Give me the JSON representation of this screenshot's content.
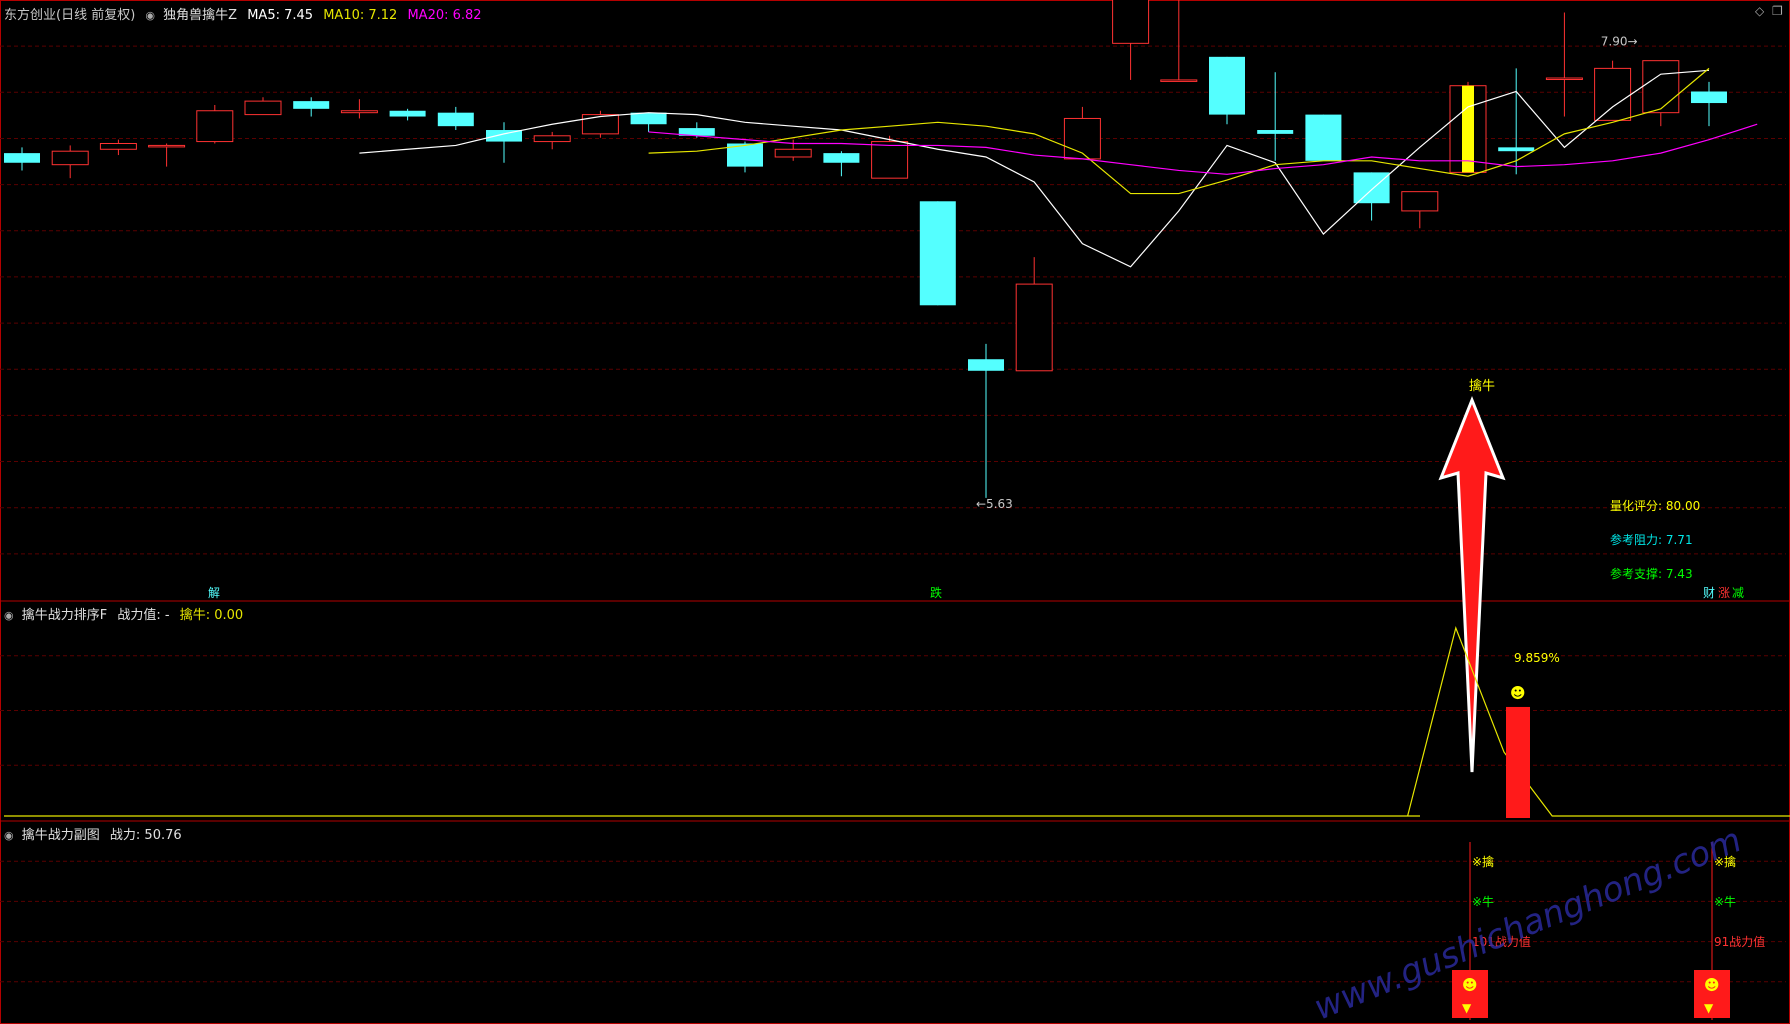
{
  "header": {
    "stock": "东方创业(日线 前复权)",
    "indicator": "独角兽擒牛Z",
    "ma5_label": "MA5: 7.45",
    "ma10_label": "MA10: 7.12",
    "ma20_label": "MA20: 6.82",
    "diamond_icon": "diamond-icon",
    "restore_icon": "window-restore-icon"
  },
  "sub1_header": {
    "name": "擒牛战力排序F",
    "label_a": "战力值: -",
    "label_b": "擒牛: 0.00"
  },
  "sub2_header": {
    "name": "擒牛战力副图",
    "label": "战力: 50.76"
  },
  "colors": {
    "up": "#ff3232",
    "down": "#54ffff",
    "ma5": "#ffffff",
    "ma10": "#e6e600",
    "ma20": "#ff00ff",
    "grid": "#5a0000",
    "frame": "#b40000",
    "yellow": "#ffff00",
    "cyan": "#00e6e6",
    "green": "#00ff00"
  },
  "chart_data": {
    "type": "candlestick",
    "ylim": [
      5.1,
      8.08
    ],
    "candles": [
      {
        "o": 7.42,
        "h": 7.45,
        "l": 7.33,
        "c": 7.37
      },
      {
        "o": 7.36,
        "h": 7.46,
        "l": 7.29,
        "c": 7.43
      },
      {
        "o": 7.44,
        "h": 7.49,
        "l": 7.41,
        "c": 7.47
      },
      {
        "o": 7.46,
        "h": 7.47,
        "l": 7.35,
        "c": 7.46
      },
      {
        "o": 7.48,
        "h": 7.67,
        "l": 7.47,
        "c": 7.64
      },
      {
        "o": 7.62,
        "h": 7.71,
        "l": 7.62,
        "c": 7.69
      },
      {
        "o": 7.69,
        "h": 7.71,
        "l": 7.61,
        "c": 7.65
      },
      {
        "o": 7.63,
        "h": 7.7,
        "l": 7.6,
        "c": 7.64
      },
      {
        "o": 7.64,
        "h": 7.65,
        "l": 7.59,
        "c": 7.61
      },
      {
        "o": 7.63,
        "h": 7.66,
        "l": 7.54,
        "c": 7.56
      },
      {
        "o": 7.54,
        "h": 7.58,
        "l": 7.37,
        "c": 7.48
      },
      {
        "o": 7.48,
        "h": 7.53,
        "l": 7.44,
        "c": 7.51
      },
      {
        "o": 7.52,
        "h": 7.64,
        "l": 7.5,
        "c": 7.62
      },
      {
        "o": 7.63,
        "h": 7.63,
        "l": 7.53,
        "c": 7.57
      },
      {
        "o": 7.55,
        "h": 7.58,
        "l": 7.5,
        "c": 7.51
      },
      {
        "o": 7.47,
        "h": 7.48,
        "l": 7.32,
        "c": 7.35
      },
      {
        "o": 7.4,
        "h": 7.49,
        "l": 7.38,
        "c": 7.44
      },
      {
        "o": 7.42,
        "h": 7.43,
        "l": 7.3,
        "c": 7.37
      },
      {
        "o": 7.29,
        "h": 7.51,
        "l": 7.29,
        "c": 7.48
      },
      {
        "o": 7.17,
        "h": 7.17,
        "l": 6.63,
        "c": 6.63
      },
      {
        "o": 6.35,
        "h": 6.43,
        "l": 5.63,
        "c": 6.29
      },
      {
        "o": 6.29,
        "h": 6.88,
        "l": 6.29,
        "c": 6.74
      },
      {
        "o": 7.39,
        "h": 7.66,
        "l": 7.39,
        "c": 7.6
      },
      {
        "o": 7.99,
        "h": 8.39,
        "l": 7.8,
        "c": 8.55
      },
      {
        "o": 7.8,
        "h": 8.32,
        "l": 7.8,
        "c": 7.8
      },
      {
        "o": 7.92,
        "h": 7.92,
        "l": 7.57,
        "c": 7.62
      },
      {
        "o": 7.54,
        "h": 7.84,
        "l": 7.38,
        "c": 7.52
      },
      {
        "o": 7.62,
        "h": 7.62,
        "l": 7.38,
        "c": 7.38
      },
      {
        "o": 7.32,
        "h": 7.32,
        "l": 7.07,
        "c": 7.16
      },
      {
        "o": 7.12,
        "h": 7.22,
        "l": 7.03,
        "c": 7.22
      },
      {
        "o": 7.32,
        "h": 7.79,
        "l": 7.32,
        "c": 7.77
      },
      {
        "o": 7.45,
        "h": 7.86,
        "l": 7.31,
        "c": 7.43
      },
      {
        "o": 7.81,
        "h": 8.15,
        "l": 7.61,
        "c": 7.81
      },
      {
        "o": 7.59,
        "h": 7.9,
        "l": 7.66,
        "c": 7.86
      },
      {
        "o": 7.63,
        "h": 7.9,
        "l": 7.56,
        "c": 7.9
      },
      {
        "o": 7.74,
        "h": 7.79,
        "l": 7.56,
        "c": 7.68
      }
    ],
    "ma5": [
      7.42,
      7.44,
      7.46,
      7.52,
      7.57,
      7.61,
      7.63,
      7.62,
      7.58,
      7.56,
      7.54,
      7.49,
      7.44,
      7.4,
      7.27,
      6.95,
      6.83,
      7.12,
      7.46,
      7.37,
      7.0,
      7.23,
      7.45,
      7.66,
      7.74,
      7.45,
      7.66,
      7.83,
      7.85
    ],
    "ma10": [
      7.42,
      7.43,
      7.46,
      7.5,
      7.54,
      7.56,
      7.58,
      7.56,
      7.52,
      7.42,
      7.21,
      7.21,
      7.28,
      7.36,
      7.38,
      7.38,
      7.34,
      7.3,
      7.38,
      7.52,
      7.58,
      7.65,
      7.86
    ],
    "ma20": [
      7.53,
      7.51,
      7.49,
      7.47,
      7.47,
      7.46,
      7.46,
      7.45,
      7.41,
      7.39,
      7.36,
      7.33,
      7.31,
      7.34,
      7.36,
      7.4,
      7.38,
      7.38,
      7.35,
      7.36,
      7.38,
      7.42,
      7.49,
      7.57
    ],
    "price_labels": {
      "low": "←5.63",
      "high": "7.90→"
    },
    "signal_label": "擒牛",
    "event_labels": [
      {
        "text": "解"
      },
      {
        "text": "跌"
      },
      {
        "text": "财"
      },
      {
        "text": "涨"
      },
      {
        "text": "减"
      }
    ],
    "info": [
      {
        "text": "量化评分: 80.00"
      },
      {
        "text": "参考阻力: 7.71"
      },
      {
        "text": "参考支撑: 7.43"
      }
    ],
    "sub1": {
      "line": [
        0,
        0,
        0,
        0,
        0,
        0,
        0,
        0,
        0,
        0,
        0,
        0,
        0,
        0,
        0,
        0,
        0,
        0,
        0,
        0,
        0,
        0,
        0,
        0,
        0,
        0,
        0,
        0,
        0,
        0,
        100,
        34,
        0,
        0,
        0,
        0,
        0,
        0
      ],
      "bar_value": 58,
      "percent_label": "9.859%"
    },
    "sub2": {
      "signals": [
        {
          "tag1": "※擒",
          "tag2": "※牛",
          "score": "101战力值"
        },
        {
          "tag1": "※擒",
          "tag2": "※牛",
          "score": "91战力值"
        }
      ]
    },
    "watermark": "www.gushichanghong.com"
  }
}
